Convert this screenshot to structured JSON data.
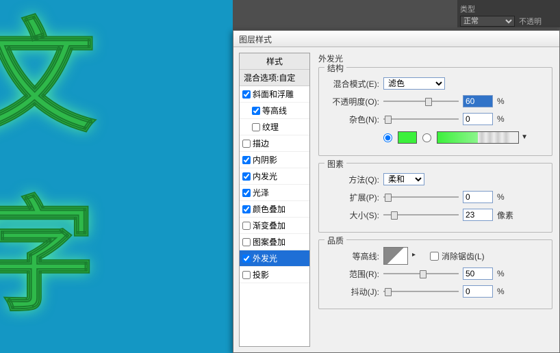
{
  "canvas": {
    "text": "文字"
  },
  "topbar": {
    "type_label": "类型",
    "blend_mode": "正常",
    "opacity_label": "不透明"
  },
  "dialog": {
    "title": "图层样式",
    "styles": {
      "header": "样式",
      "blend_options": "混合选项:自定",
      "items": [
        {
          "label": "斜面和浮雕",
          "checked": true,
          "indent": false
        },
        {
          "label": "等高线",
          "checked": true,
          "indent": true
        },
        {
          "label": "纹理",
          "checked": false,
          "indent": true
        },
        {
          "label": "描边",
          "checked": false,
          "indent": false
        },
        {
          "label": "内阴影",
          "checked": true,
          "indent": false
        },
        {
          "label": "内发光",
          "checked": true,
          "indent": false
        },
        {
          "label": "光泽",
          "checked": true,
          "indent": false
        },
        {
          "label": "颜色叠加",
          "checked": true,
          "indent": false
        },
        {
          "label": "渐变叠加",
          "checked": false,
          "indent": false
        },
        {
          "label": "图案叠加",
          "checked": false,
          "indent": false
        },
        {
          "label": "外发光",
          "checked": true,
          "indent": false,
          "selected": true
        },
        {
          "label": "投影",
          "checked": false,
          "indent": false
        }
      ]
    },
    "panel": {
      "title": "外发光",
      "structure": {
        "legend": "结构",
        "blend_mode_label": "混合模式(E):",
        "blend_mode_value": "滤色",
        "opacity_label": "不透明度(O):",
        "opacity_value": "60",
        "opacity_unit": "%",
        "opacity_thumb_pct": 55,
        "noise_label": "杂色(N):",
        "noise_value": "0",
        "noise_unit": "%",
        "noise_thumb_pct": 2,
        "color_selected": "solid"
      },
      "elements": {
        "legend": "图素",
        "technique_label": "方法(Q):",
        "technique_value": "柔和",
        "spread_label": "扩展(P):",
        "spread_value": "0",
        "spread_unit": "%",
        "spread_thumb_pct": 2,
        "size_label": "大小(S):",
        "size_value": "23",
        "size_unit": "像素",
        "size_thumb_pct": 10
      },
      "quality": {
        "legend": "品质",
        "contour_label": "等高线:",
        "antialias_label": "消除锯齿(L)",
        "antialias_checked": false,
        "range_label": "范围(R):",
        "range_value": "50",
        "range_unit": "%",
        "range_thumb_pct": 48,
        "jitter_label": "抖动(J):",
        "jitter_value": "0",
        "jitter_unit": "%",
        "jitter_thumb_pct": 2
      }
    }
  }
}
